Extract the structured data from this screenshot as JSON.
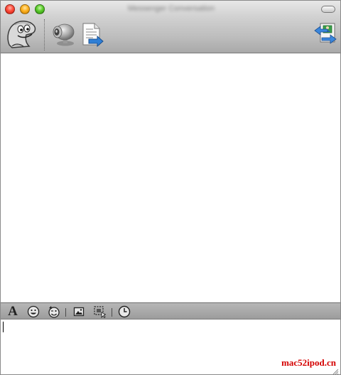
{
  "window": {
    "title": "Messenger Conversation"
  },
  "toolbar": {
    "icons": [
      "mascot-icon",
      "webcam-icon",
      "send-file-icon",
      "switch-view-icon"
    ]
  },
  "formatbar": {
    "font_label": "A",
    "icons": [
      "font-icon",
      "emoticon-icon",
      "wink-icon",
      "image-icon",
      "screenshot-icon",
      "history-icon"
    ]
  },
  "input": {
    "value": ""
  },
  "watermark": {
    "text": "mac52ipod.cn"
  },
  "colors": {
    "watermark": "#d40000",
    "close": "#ff4b3a",
    "minimize": "#ffb21f",
    "zoom": "#5bcc2c"
  }
}
